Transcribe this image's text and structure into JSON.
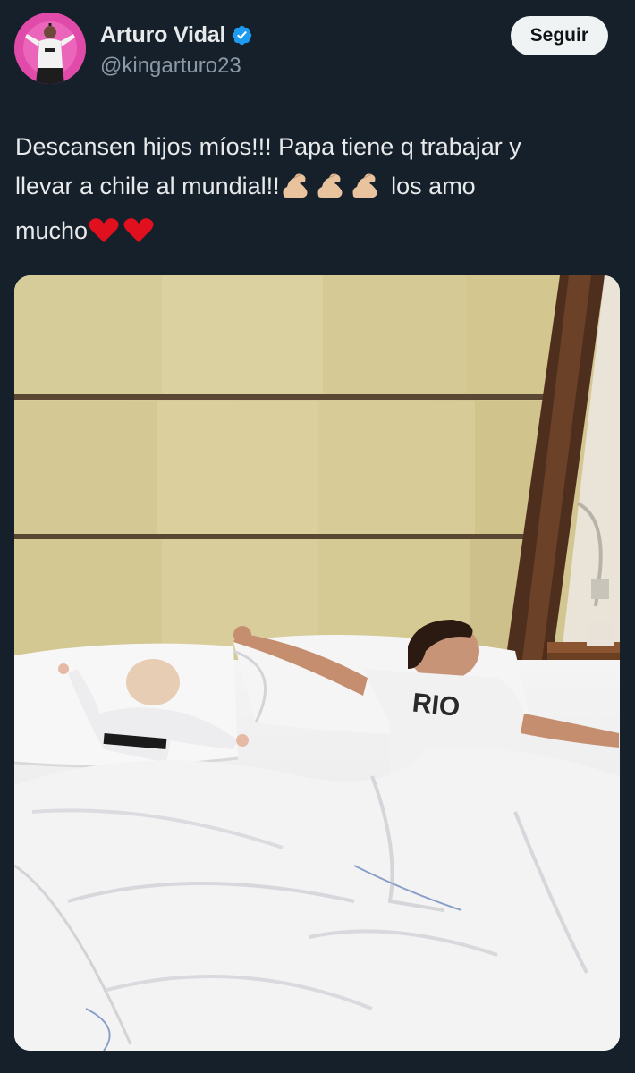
{
  "author": {
    "display_name": "Arturo Vidal",
    "handle": "@kingarturo23",
    "verified": true,
    "avatar_icon": "profile-photo-icon"
  },
  "follow_button": {
    "label": "Seguir"
  },
  "tweet": {
    "text_line1": "Descansen hijos míos!!! Papa tiene q trabajar y",
    "text_line2_start": "llevar a chile al mundial!!",
    "text_line2_end": " los amo",
    "text_line3": "mucho",
    "emojis": [
      "flexed-biceps-icon",
      "flexed-biceps-icon",
      "flexed-biceps-icon",
      "red-heart-icon",
      "red-heart-icon"
    ]
  },
  "colors": {
    "background": "#15202b",
    "text": "#e7e9ea",
    "secondary_text": "#8b98a5",
    "verified_blue": "#1d9bf0",
    "button_bg": "#eff3f4"
  }
}
